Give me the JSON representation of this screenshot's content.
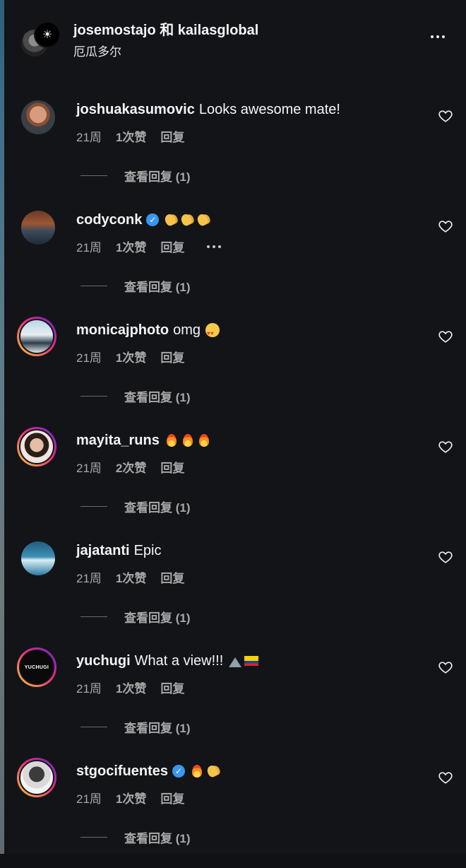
{
  "header": {
    "title": "josemostajo 和 kailasglobal",
    "location": "厄瓜多尔",
    "more_icon": "more-horizontal-icon"
  },
  "comments": [
    {
      "username": "joshuakasumovic",
      "text": "Looks awesome mate!",
      "verified": false,
      "emojis": [],
      "time": "21周",
      "likes": "1次赞",
      "reply": "回复",
      "view_replies": "查看回复 (1)",
      "has_story_ring": false,
      "has_more": false
    },
    {
      "username": "codyconk",
      "text": "",
      "verified": true,
      "emojis": [
        "clap",
        "clap",
        "clap"
      ],
      "time": "21周",
      "likes": "1次赞",
      "reply": "回复",
      "view_replies": "查看回复 (1)",
      "has_story_ring": false,
      "has_more": true
    },
    {
      "username": "monicajphoto",
      "text": "omg",
      "verified": false,
      "emojis": [
        "heart-eyes"
      ],
      "time": "21周",
      "likes": "1次赞",
      "reply": "回复",
      "view_replies": "查看回复 (1)",
      "has_story_ring": true,
      "has_more": false
    },
    {
      "username": "mayita_runs",
      "text": "",
      "verified": false,
      "emojis": [
        "fire",
        "fire",
        "fire"
      ],
      "time": "21周",
      "likes": "2次赞",
      "reply": "回复",
      "view_replies": "查看回复 (1)",
      "has_story_ring": true,
      "has_more": false
    },
    {
      "username": "jajatanti",
      "text": "Epic",
      "verified": false,
      "emojis": [],
      "time": "21周",
      "likes": "1次赞",
      "reply": "回复",
      "view_replies": "查看回复 (1)",
      "has_story_ring": false,
      "has_more": false
    },
    {
      "username": "yuchugi",
      "text": "What a view!!!",
      "verified": false,
      "emojis": [
        "mountain",
        "flag"
      ],
      "avatar_text": "YUCHUGI",
      "time": "21周",
      "likes": "1次赞",
      "reply": "回复",
      "view_replies": "查看回复 (1)",
      "has_story_ring": true,
      "has_more": false
    },
    {
      "username": "stgocifuentes",
      "text": "",
      "verified": true,
      "emojis": [
        "fire",
        "clap"
      ],
      "time": "21周",
      "likes": "1次赞",
      "reply": "回复",
      "view_replies": "查看回复 (1)",
      "has_story_ring": true,
      "has_more": false
    }
  ],
  "colors": {
    "background": "#121418",
    "text_primary": "#f5f5f5",
    "text_secondary": "#a8a8a8",
    "verified": "#3897f0"
  },
  "icons": {
    "like": "heart-outline-icon",
    "verified": "verified-badge-icon",
    "more": "more-horizontal-icon"
  }
}
